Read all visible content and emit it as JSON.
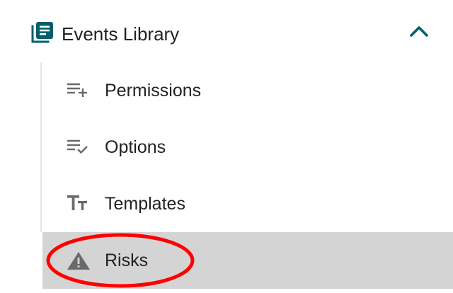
{
  "nav": {
    "section": {
      "label": "Events Library",
      "icon": "library-books-icon",
      "expanded": true,
      "accent_color": "#00606b"
    },
    "items": [
      {
        "label": "Permissions",
        "icon": "playlist-add-icon"
      },
      {
        "label": "Options",
        "icon": "playlist-check-icon"
      },
      {
        "label": "Templates",
        "icon": "text-size-icon"
      },
      {
        "label": "Risks",
        "icon": "warning-icon",
        "selected": true
      }
    ]
  },
  "colors": {
    "selected_background": "#d4d4d4",
    "icon_gray": "#6a6a6a",
    "annotation_red": "#ff0000"
  }
}
